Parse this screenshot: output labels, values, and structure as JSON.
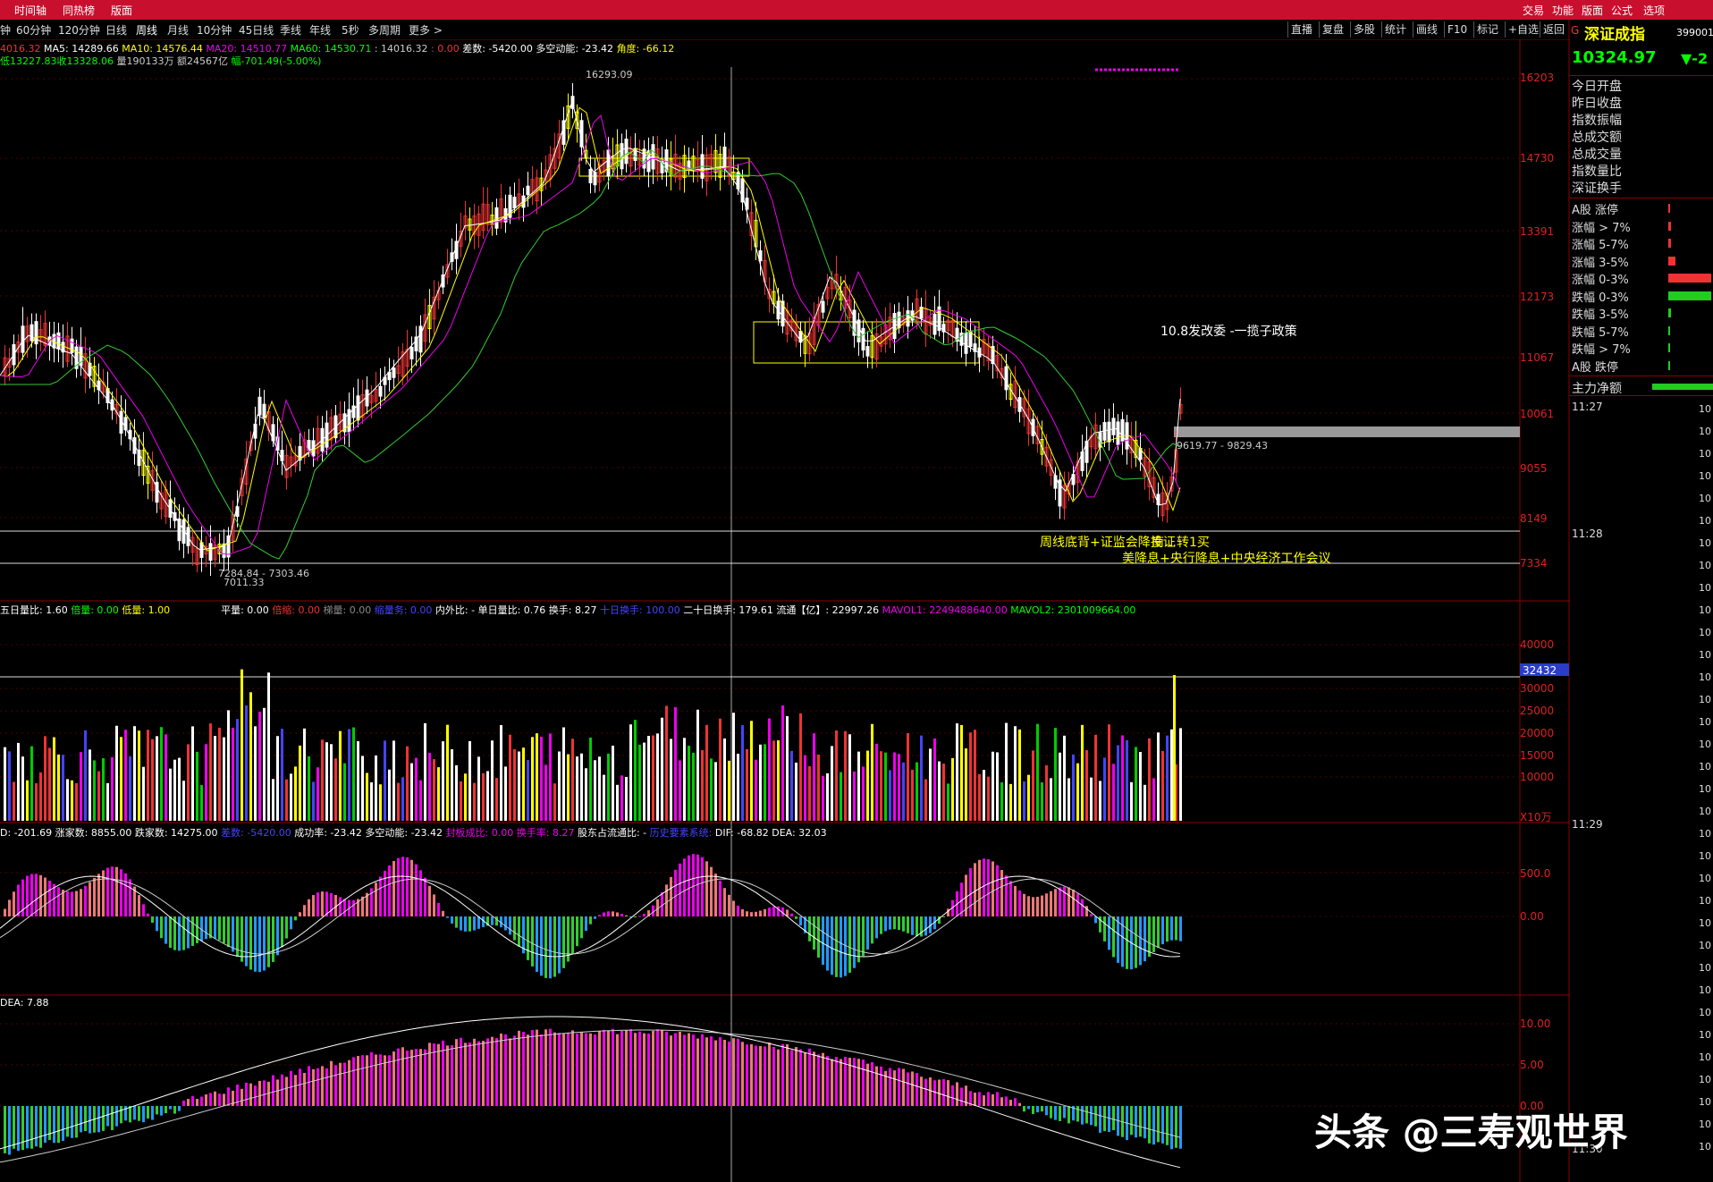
{
  "top_menu": {
    "left": [
      "时间轴",
      "同热榜",
      "版面"
    ],
    "right": [
      "交易",
      "功能",
      "版面",
      "公式",
      "选项"
    ]
  },
  "timeframes": [
    "钟",
    "60分钟",
    "120分钟",
    "日线",
    "周线",
    "月线",
    "10分钟",
    "45日线",
    "季线",
    "年线",
    "5秒",
    "多周期",
    "更多 >"
  ],
  "active_timeframe": "周线",
  "toolbar": [
    "直播",
    "复盘",
    "多股",
    "统计",
    "画线",
    "F10",
    "标记",
    "+自选",
    "返回"
  ],
  "ma_line": {
    "close": "4016.32",
    "ma5": "MA5: 14289.66",
    "ma10": "MA10: 14576.44",
    "ma20": "MA20: 14510.77",
    "ma60": "MA60: 14530.71",
    "val": ": 14016.32",
    "zero": ": 0.00",
    "diff": "差数: -5420.00",
    "dkdn": "多空动能: -23.42",
    "angle": "角度: -66.12"
  },
  "ohlc_line": {
    "low": "低13227.83",
    "close": "收13328.06",
    "vol": "量190133万",
    "amt": "额24567亿",
    "chg": "幅-701.49(-5.00%)"
  },
  "price_axis": [
    "16203",
    "14730",
    "13391",
    "12173",
    "11067",
    "10061",
    "9055",
    "8149",
    "7334"
  ],
  "price_annotations": {
    "high": "16293.09",
    "low_a": "7284.84 - 7303.46",
    "low_b": "7011.33",
    "zone": "9619.77 - 9829.43"
  },
  "notes": {
    "policy": "10.8发改委 -一揽子政策",
    "bottom_a": "周线底背+证监会降投证",
    "bottom_b": "美降息+央行降息+中央经济工作会议",
    "bottom_c": "南…转1买"
  },
  "vol_info": {
    "five_day": "五日量比: 1.60",
    "bei": "倍量: 0.00",
    "di": "低量: 1.00",
    "ping": "平量: 0.00",
    "beisuo": "倍缩: 0.00",
    "tiliang": "梯量: 0.00",
    "suo": "缩量务: 0.00",
    "neiwai": "内外比: - 单日量比: 0.76",
    "huanshou": "换手: 8.27",
    "shiri": "十日换手: 100.00",
    "ershi": "二十日换手: 179.61",
    "liutong": "流通【亿】: 22997.26",
    "mavol1": "MAVOL1: 2249488640.00",
    "mavol2": "MAVOL2: 2301009664.00"
  },
  "vol_axis": [
    "40000",
    "30000",
    "25000",
    "20000",
    "15000",
    "10000"
  ],
  "vol_marker": "32432",
  "vol_unit": "X10万",
  "ind1_info": {
    "d": "D: -201.69",
    "zhang": "涨家数: 8855.00",
    "die": "跌家数: 14275.00",
    "chashu": "差数: -5420.00",
    "cgl": "成功率: -23.42",
    "dkdn": "多空动能: -23.42",
    "fengban": "封板成比: 0.00",
    "hsl": "换手率: 8.27",
    "gudong": "股东占流通比: -",
    "lishi": "历史要素系统:",
    "dif": "DIF: -68.82",
    "dea": "DEA: 32.03"
  },
  "ind1_axis": [
    "500.0",
    "0.00"
  ],
  "ind2_info": {
    "dea": "DEA: 7.88"
  },
  "ind2_axis": [
    "10.00",
    "5.00",
    "0.00"
  ],
  "right_panel": {
    "g": "G",
    "name": "深证成指",
    "code": "399001",
    "price": "10324.97",
    "change": "▼-2",
    "rows": [
      "今日开盘",
      "昨日收盘",
      "指数振幅",
      "总成交额",
      "总成交量",
      "指数量比",
      "深证换手"
    ],
    "dist_rows": [
      {
        "label": "A股 涨停",
        "color": "#e33",
        "fill": 0.04
      },
      {
        "label": "涨幅 > 7%",
        "color": "#e33",
        "fill": 0.05
      },
      {
        "label": "涨幅 5-7%",
        "color": "#e33",
        "fill": 0.06
      },
      {
        "label": "涨幅 3-5%",
        "color": "#e33",
        "fill": 0.15
      },
      {
        "label": "涨幅 0-3%",
        "color": "#e33",
        "fill": 0.95
      },
      {
        "label": "跌幅 0-3%",
        "color": "#2c2",
        "fill": 0.95
      },
      {
        "label": "跌幅 3-5%",
        "color": "#2c2",
        "fill": 0.05
      },
      {
        "label": "跌幅 5-7%",
        "color": "#2c2",
        "fill": 0.02
      },
      {
        "label": "跌幅 > 7%",
        "color": "#2c2",
        "fill": 0.01
      },
      {
        "label": "A股 跌停",
        "color": "#2c2",
        "fill": 0.01
      }
    ],
    "net_flow_label": "主力净额",
    "times": [
      "11:27",
      "11:28",
      "11:29",
      "11:30"
    ]
  },
  "watermark": "头条 @三寿观世界",
  "colors": {
    "up": "#e23",
    "down": "#0f0",
    "accent_bar": "#c8102e",
    "yellow": "#ff0"
  }
}
